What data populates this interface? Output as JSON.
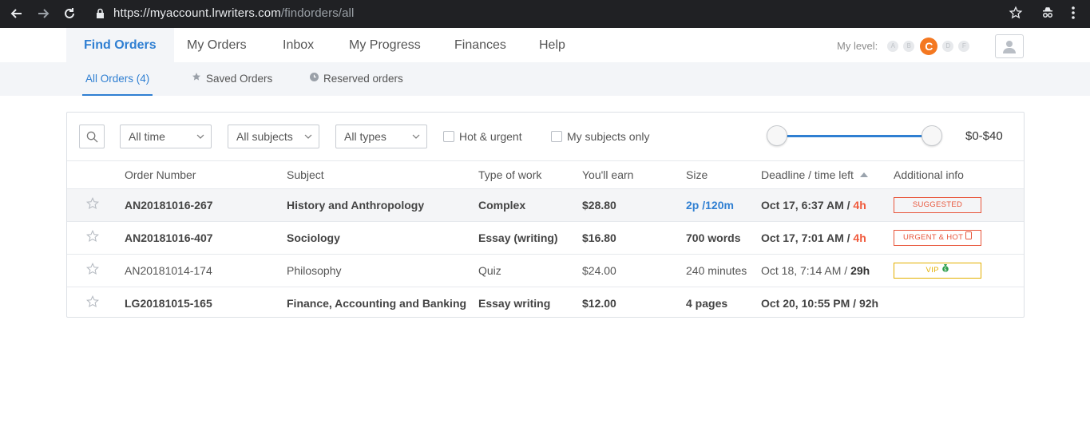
{
  "browser": {
    "url_host": "https://myaccount.lrwriters.com",
    "url_path": "/findorders/all"
  },
  "nav": {
    "tabs": [
      {
        "label": "Find Orders",
        "active": true
      },
      {
        "label": "My Orders"
      },
      {
        "label": "Inbox"
      },
      {
        "label": "My Progress"
      },
      {
        "label": "Finances"
      },
      {
        "label": "Help"
      }
    ],
    "level_label": "My level:",
    "levels": [
      "A",
      "B",
      "C",
      "D",
      "F"
    ],
    "current_level": "C",
    "accent_color": "#2f7fd2",
    "level_color": "#f47821"
  },
  "subnav": {
    "all_orders": "All Orders (4)",
    "saved_orders": "Saved Orders",
    "reserved_orders": "Reserved orders"
  },
  "filters": {
    "time": "All time",
    "subjects": "All subjects",
    "types": "All types",
    "hot_urgent": "Hot & urgent",
    "my_subjects": "My subjects only",
    "price_range": "$0-$40",
    "slider_min_fraction": 0.0,
    "slider_max_fraction": 1.0
  },
  "table": {
    "headers": {
      "order_number": "Order Number",
      "subject": "Subject",
      "type": "Type of work",
      "earn": "You'll earn",
      "size": "Size",
      "deadline": "Deadline / time left",
      "info": "Additional info"
    },
    "rows": [
      {
        "order": "AN20181016-267",
        "subject": "History and Anthropology",
        "type": "Complex",
        "earn": "$28.80",
        "size": "2p /120m",
        "deadline": "Oct 17, 6:37 AM / ",
        "left": "4h",
        "badge": "SUGGESTED"
      },
      {
        "order": "AN20181016-407",
        "subject": "Sociology",
        "type": "Essay (writing)",
        "earn": "$16.80",
        "size": "700 words",
        "deadline": "Oct 17, 7:01 AM / ",
        "left": "4h",
        "badge": "URGENT & HOT"
      },
      {
        "order": "AN20181014-174",
        "subject": "Philosophy",
        "type": "Quiz",
        "earn": "$24.00",
        "size": "240 minutes",
        "deadline": "Oct 18, 7:14 AM / ",
        "left": "29h",
        "badge": "VIP"
      },
      {
        "order": "LG20181015-165",
        "subject": "Finance, Accounting and Banking",
        "type": "Essay writing",
        "earn": "$12.00",
        "size": "4 pages",
        "deadline": "Oct 20, 10:55 PM / 92h",
        "left": "",
        "badge": ""
      }
    ]
  }
}
